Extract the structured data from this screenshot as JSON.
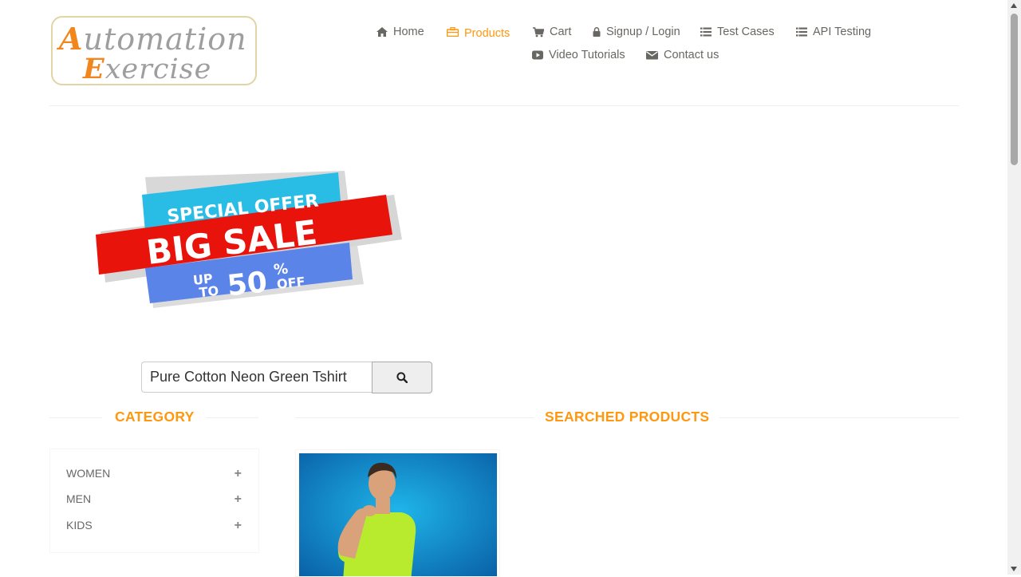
{
  "logo": {
    "line1_cap": "A",
    "line1_rest": "utomation",
    "line2_cap": "E",
    "line2_rest": "xercise"
  },
  "nav": [
    {
      "label": "Home",
      "icon": "home-icon"
    },
    {
      "label": "Products",
      "icon": "briefcase-icon",
      "active": true
    },
    {
      "label": "Cart",
      "icon": "cart-icon"
    },
    {
      "label": "Signup / Login",
      "icon": "lock-icon"
    },
    {
      "label": "Test Cases",
      "icon": "list-icon"
    },
    {
      "label": "API Testing",
      "icon": "list-icon"
    },
    {
      "label": "Video Tutorials",
      "icon": "youtube-play-icon"
    },
    {
      "label": "Contact us",
      "icon": "envelope-icon"
    }
  ],
  "banner": {
    "line1": "SPECIAL OFFER",
    "line2": "BIG SALE",
    "up": "UP",
    "to": "TO",
    "pct": "50",
    "pct_sign": "%",
    "off": "OFF"
  },
  "search": {
    "value": "Pure Cotton Neon Green Tshirt",
    "button_icon": "search-icon"
  },
  "category": {
    "title": "Category",
    "items": [
      {
        "label": "WOMEN"
      },
      {
        "label": "MEN"
      },
      {
        "label": "KIDS"
      }
    ]
  },
  "products": {
    "title": "Searched Products"
  },
  "colors": {
    "accent": "#fe980f",
    "text": "#696763",
    "banner_cyan": "#29bde6",
    "banner_red": "#e8140c",
    "banner_blue": "#5b84e8"
  }
}
